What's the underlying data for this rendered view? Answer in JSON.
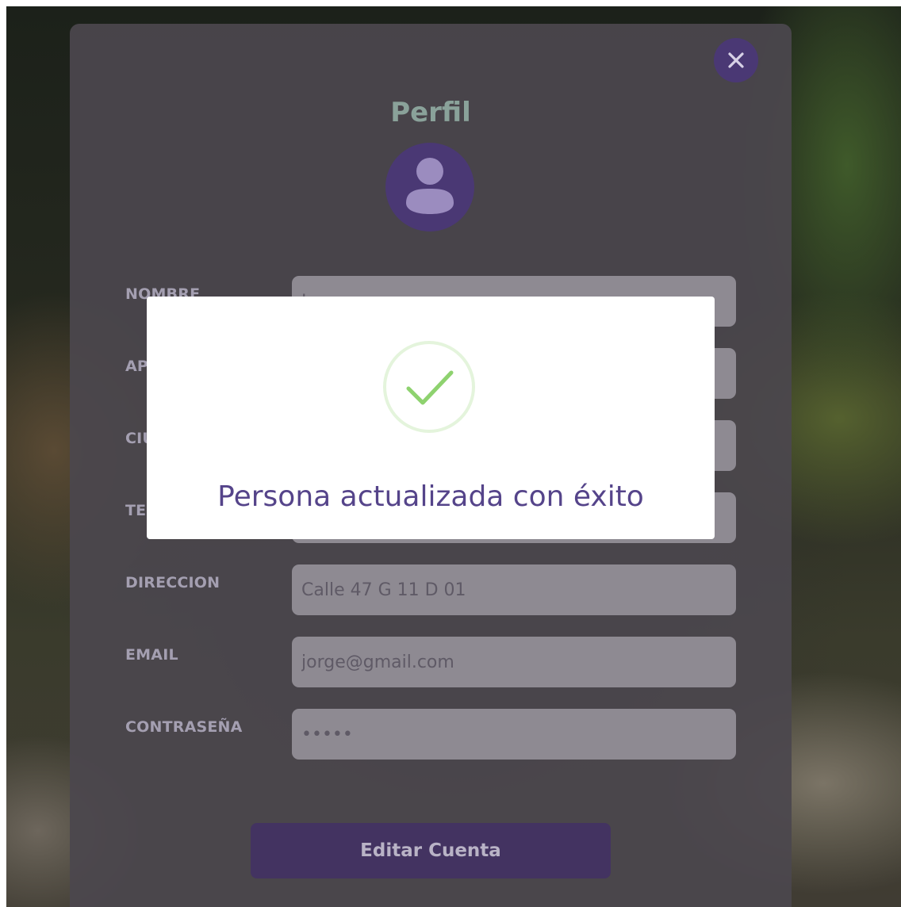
{
  "profile": {
    "title": "Perfil",
    "avatar_icon": "user-avatar-icon",
    "close_icon": "close-icon",
    "fields": [
      {
        "label": "NOMBRE",
        "value": "J"
      },
      {
        "label": "APELLIDO",
        "value": ""
      },
      {
        "label": "CIUDAD",
        "value": ""
      },
      {
        "label": "TELEFONO",
        "value": ""
      },
      {
        "label": "DIRECCION",
        "value": "Calle 47 G 11 D 01"
      },
      {
        "label": "EMAIL",
        "value": "jorge@gmail.com"
      },
      {
        "label": "CONTRASEÑA",
        "value": "•••••"
      }
    ],
    "submit_label": "Editar Cuenta"
  },
  "alert": {
    "icon": "success-check-icon",
    "message": "Persona actualizada con éxito"
  },
  "colors": {
    "accent": "#4a3874",
    "title_teal": "#8aa29a",
    "alert_text": "#55448a",
    "success_green": "#8ed26f"
  }
}
